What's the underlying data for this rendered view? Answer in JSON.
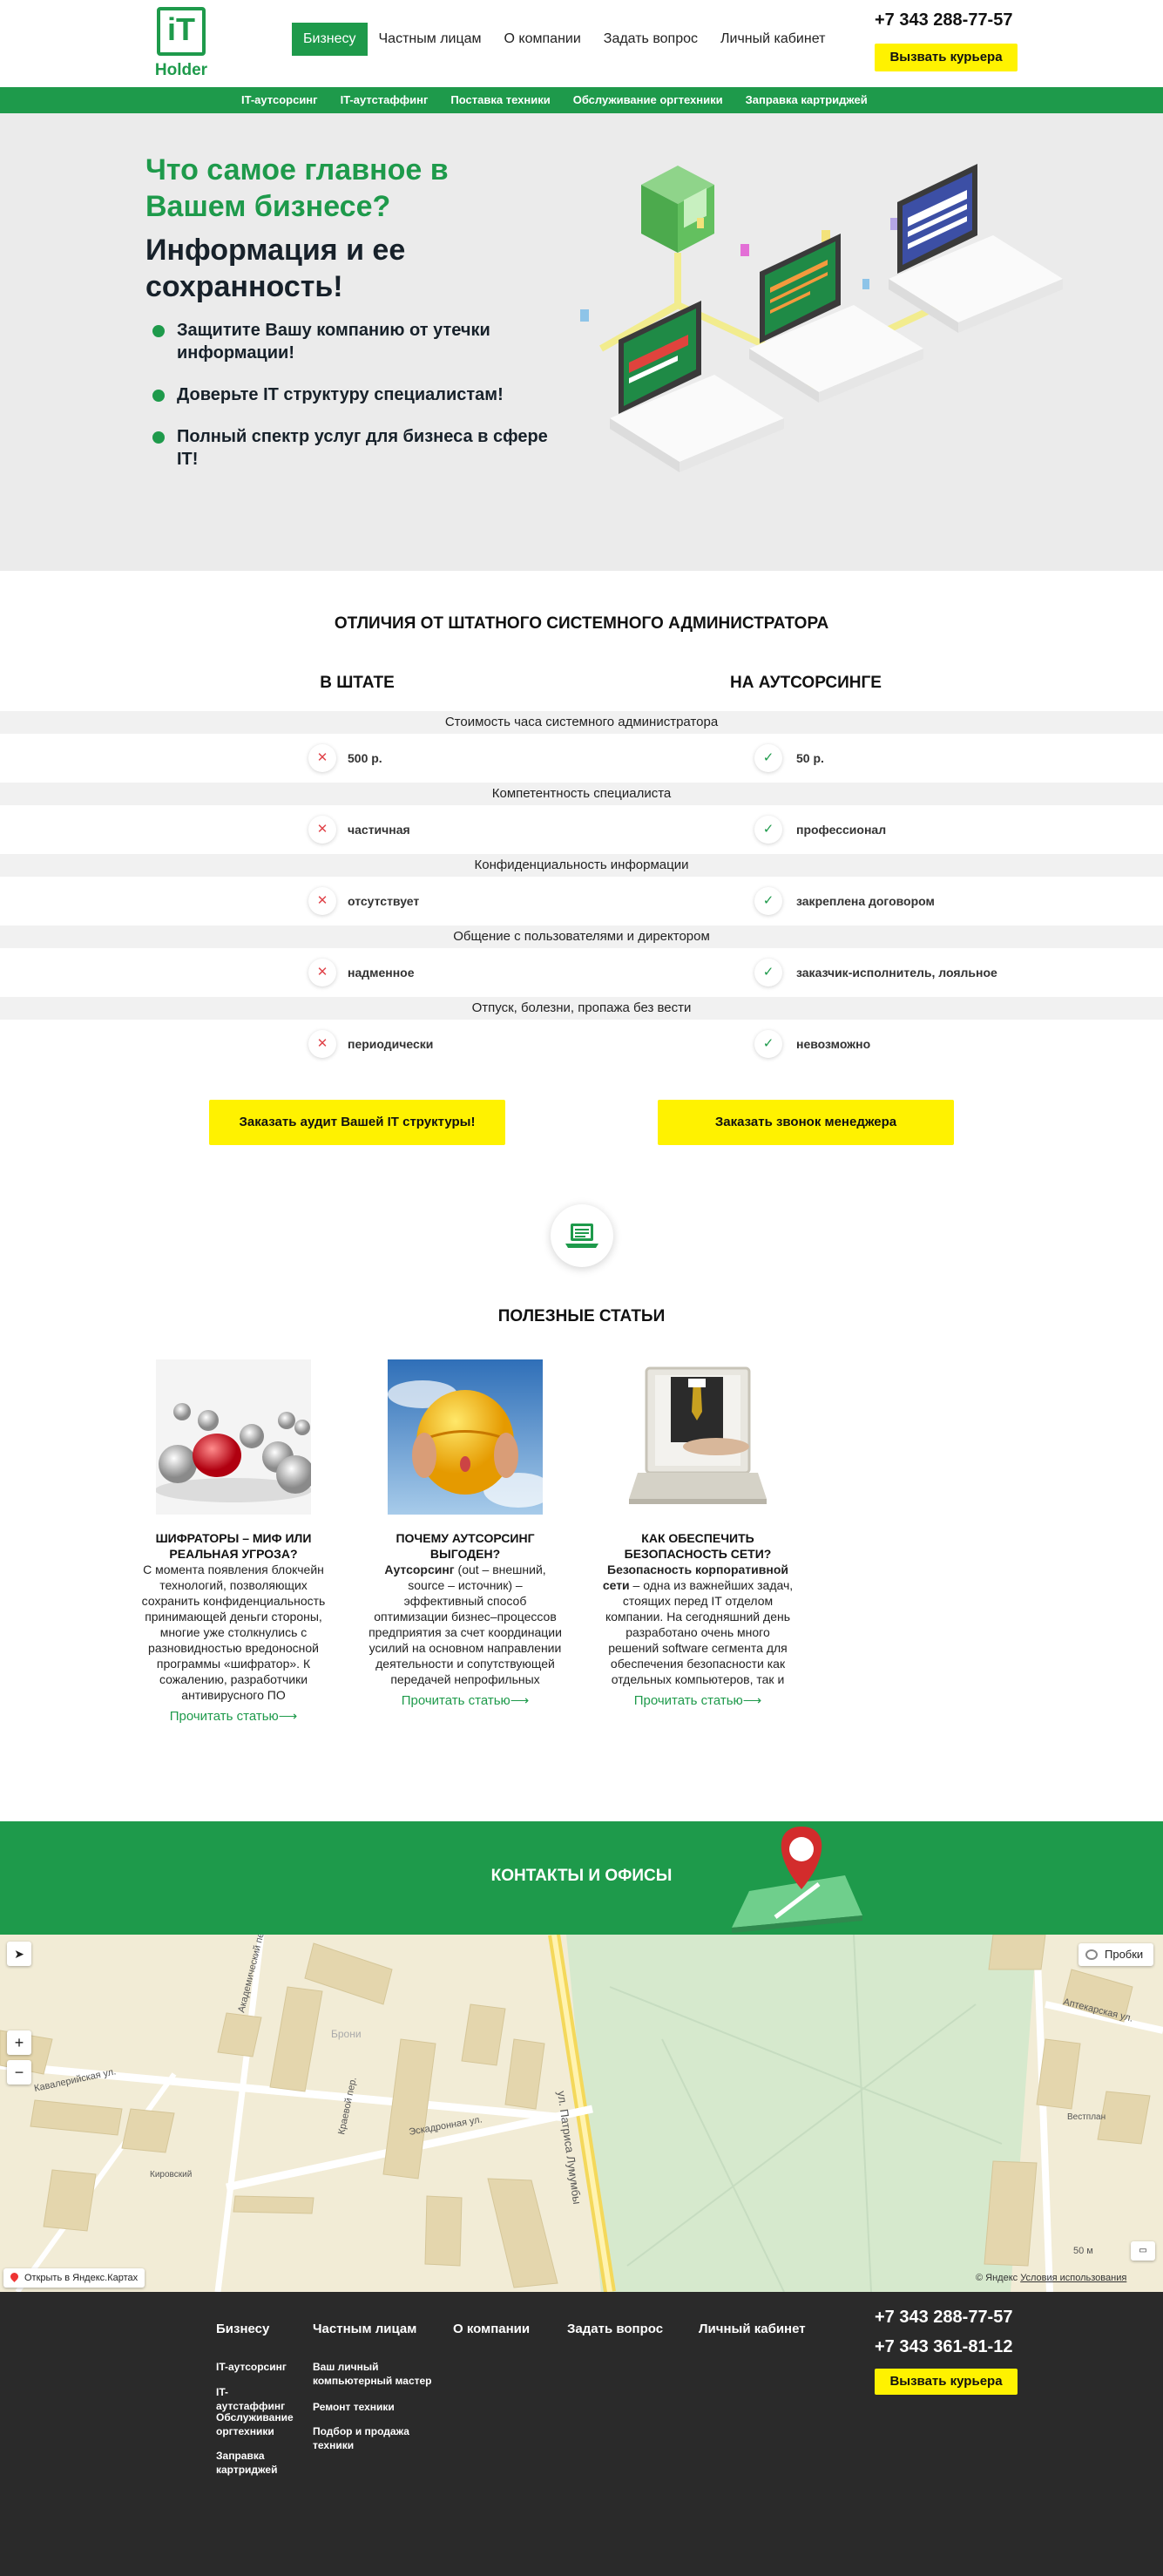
{
  "header": {
    "logo": {
      "top": "iT",
      "bottom": "Holder"
    },
    "nav": [
      {
        "label": "Бизнесу",
        "active": true
      },
      {
        "label": "Частным лицам"
      },
      {
        "label": "О компании"
      },
      {
        "label": "Задать вопрос"
      },
      {
        "label": "Личный кабинет"
      }
    ],
    "phone": "+7 343 288-77-57",
    "courier_button": "Вызвать курьера"
  },
  "subnav": [
    "IT-аутсорсинг",
    "IT-аутстаффинг",
    "Поставка техники",
    "Обслуживание оргтехники",
    "Заправка картриджей"
  ],
  "hero": {
    "heading": "Что самое главное в Вашем бизнесе?",
    "subheading": "Информация и ее сохранность!",
    "bullets": [
      "Защитите Вашу компанию от утечки информации!",
      "Доверьте IT структуру специалистам!",
      "Полный спектр услуг для бизнеса в сфере IT!"
    ]
  },
  "comparison": {
    "title": "ОТЛИЧИЯ ОТ ШТАТНОГО СИСТЕМНОГО АДМИНИСТРАТОРА",
    "col_left": "В ШТАТЕ",
    "col_right": "НА АУТСОРСИНГЕ",
    "rows": [
      {
        "caption": "Стоимость часа системного администратора",
        "left": "500 р.",
        "right": "50 р."
      },
      {
        "caption": "Компетентность специалиста",
        "left": "частичная",
        "right": "профессионал"
      },
      {
        "caption": "Конфиденциальность информации",
        "left": "отсутствует",
        "right": "закреплена договором"
      },
      {
        "caption": "Общение с пользователями и директором",
        "left": "надменное",
        "right": "заказчик-исполнитель, лояльное"
      },
      {
        "caption": "Отпуск, болезни, пропажа без вести",
        "left": "периодически",
        "right": "невозможно"
      }
    ],
    "mark_no": "✕",
    "mark_yes": "✓",
    "button_audit": "Заказать аудит Вашей IT структуры!",
    "button_call": "Заказать звонок менеджера"
  },
  "articles": {
    "title": "ПОЛЕЗНЫЕ СТАТЬИ",
    "read_more": "Прочитать статью⟶",
    "items": [
      {
        "title": "ШИФРАТОРЫ – МИФ ИЛИ РЕАЛЬНАЯ УГРОЗА?",
        "lead": "",
        "text": "С момента появления блокчейн технологий, позволяющих сохранить конфиденциальность принимающей деньги стороны, многие уже столкнулись с разновидностью вредоносной программы «шифратор». К сожалению, разработчики антивирусного ПО"
      },
      {
        "title": "ПОЧЕМУ АУТСОРСИНГ ВЫГОДЕН?",
        "lead": "Аутсорсинг",
        "text": " (out – внешний, source – источник) – эффективный способ оптимизации бизнес–процессов предприятия за счет координации усилий на основном направлении деятельности и сопутствующей передачей непрофильных"
      },
      {
        "title": "КАК ОБЕСПЕЧИТЬ БЕЗОПАСНОСТЬ СЕТИ?",
        "lead": "Безопасность корпоративной сети",
        "text": " – одна из важнейших задач, стоящих перед IT отделом компании. На сегодняшний день разработано очень много решений software сегмента для обеспечения безопасности как отдельных компьютеров, так и"
      }
    ]
  },
  "contacts": {
    "title": "КОНТАКТЫ И ОФИСЫ"
  },
  "map": {
    "traffic": "Пробки",
    "open_link": "Открыть в Яндекс.Картах",
    "copyright": "© Яндекс",
    "terms": "Условия использования",
    "scale": "50 м",
    "labels": {
      "street_lumumba": "ул. Патриса Лумумбы",
      "street_eskadronnaya": "Эскадронная ул.",
      "street_kavaleriyskaya": "Кавалерийская ул.",
      "street_aptekarskaya": "Аптекарская ул.",
      "street_kraevoy": "Краевой пер.",
      "street_akadem": "Академический пер.",
      "broni": "Брони",
      "kirovsky": "Кировский",
      "vestplan": "Вестплан"
    }
  },
  "footer": {
    "nav": [
      "Бизнесу",
      "Частным лицам",
      "О компании",
      "Задать вопрос",
      "Личный кабинет"
    ],
    "business_links": [
      "IT-аутсорсинг",
      "IT-аутстаффинг",
      "Обслуживание оргтехники",
      "Заправка картриджей"
    ],
    "private_links": [
      "Ваш личный компьютерный мастер",
      "Ремонт техники",
      "Подбор и продажа техники"
    ],
    "phone1": "+7 343 288-77-57",
    "phone2": "+7 343 361-81-12",
    "courier_button": "Вызвать курьера"
  },
  "colors": {
    "brand_green": "#1e9a4b",
    "accent_yellow": "#fff200",
    "footer_bg": "#2a2a2a"
  }
}
